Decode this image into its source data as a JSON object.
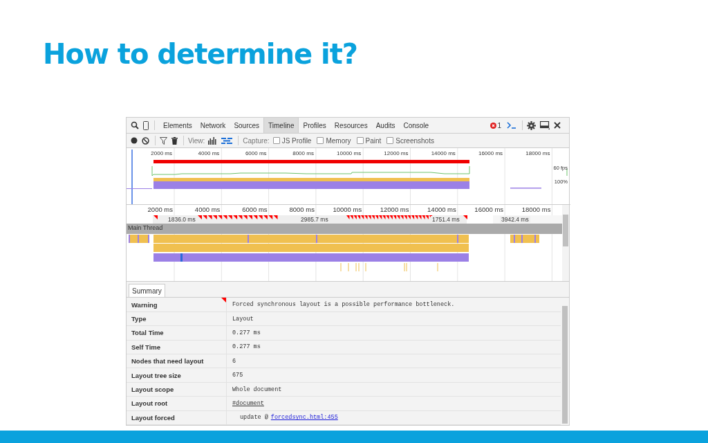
{
  "slide_title": "How to determine it?",
  "devtools": {
    "tabs": [
      {
        "label": "Elements",
        "selected": false
      },
      {
        "label": "Network",
        "selected": false
      },
      {
        "label": "Sources",
        "selected": false
      },
      {
        "label": "Timeline",
        "selected": true
      },
      {
        "label": "Profiles",
        "selected": false
      },
      {
        "label": "Resources",
        "selected": false
      },
      {
        "label": "Audits",
        "selected": false
      },
      {
        "label": "Console",
        "selected": false
      }
    ],
    "error_count": "1",
    "toolbar": {
      "view_label": "View:",
      "capture_label": "Capture:",
      "options": [
        {
          "label": "JS Profile",
          "checked": false
        },
        {
          "label": "Memory",
          "checked": false
        },
        {
          "label": "Paint",
          "checked": false
        },
        {
          "label": "Screenshots",
          "checked": false
        }
      ]
    },
    "overview": {
      "ticks": [
        "2000 ms",
        "4000 ms",
        "6000 ms",
        "8000 ms",
        "10000 ms",
        "12000 ms",
        "14000 ms",
        "16000 ms",
        "18000 ms"
      ],
      "fps_label": "60 fps",
      "cpu_label": "100%"
    },
    "flame": {
      "ticks": [
        "2000 ms",
        "4000 ms",
        "6000 ms",
        "8000 ms",
        "10000 ms",
        "12000 ms",
        "14000 ms",
        "16000 ms",
        "18000 ms"
      ],
      "frames": [
        "1836.0 ms",
        "2985.7 ms",
        "1751.4 ms",
        "3942.4 ms"
      ],
      "track_label": "Main Thread"
    },
    "summary": {
      "tab": "Summary",
      "rows": [
        {
          "label": "Warning",
          "kind": "text",
          "value": "Forced synchronous layout is a possible performance bottleneck.",
          "flagged": true
        },
        {
          "label": "Type",
          "kind": "text",
          "value": "Layout",
          "flagged": false
        },
        {
          "label": "Total Time",
          "kind": "text",
          "value": "0.277 ms",
          "flagged": false
        },
        {
          "label": "Self Time",
          "kind": "text",
          "value": "0.277 ms",
          "flagged": false
        },
        {
          "label": "Nodes that need layout",
          "kind": "text",
          "value": "6",
          "flagged": false
        },
        {
          "label": "Layout tree size",
          "kind": "text",
          "value": "675",
          "flagged": false
        },
        {
          "label": "Layout scope",
          "kind": "text",
          "value": "Whole document",
          "flagged": false
        },
        {
          "label": "Layout root",
          "kind": "node",
          "value": "#document",
          "flagged": false
        },
        {
          "label": "Layout forced",
          "kind": "call",
          "value": "update @",
          "link": "forcedsync.html:455",
          "flagged": false
        }
      ]
    }
  }
}
